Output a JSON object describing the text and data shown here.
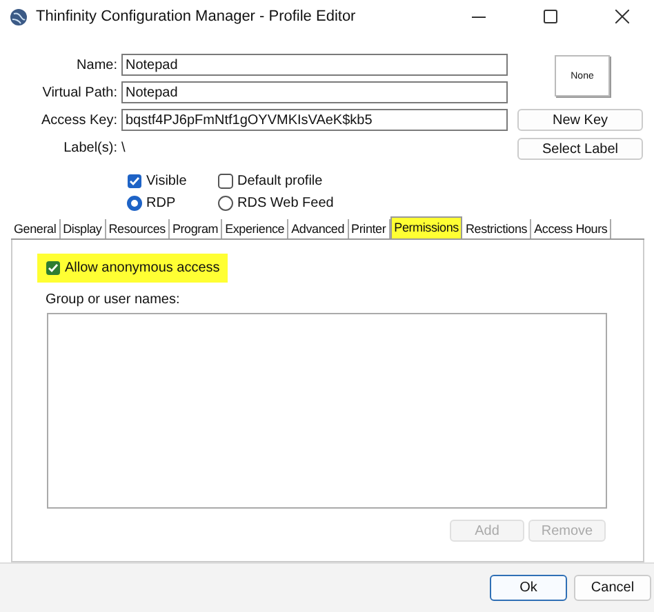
{
  "window": {
    "title": "Thinfinity Configuration Manager - Profile Editor"
  },
  "fields": [
    {
      "label": "Name:",
      "value": "Notepad"
    },
    {
      "label": "Virtual Path:",
      "value": "Notepad"
    },
    {
      "label": "Access Key:",
      "value": "bqstf4PJ6pFmNtf1gOYVMKIsVAeK$kb5"
    }
  ],
  "labels_row": {
    "label": "Label(s):",
    "value": "\\"
  },
  "icon_preview": {
    "text": "None"
  },
  "side_buttons": [
    "New Key",
    "Select Label"
  ],
  "options": [
    {
      "kind": "checkbox",
      "label": "Visible",
      "checked": true
    },
    {
      "kind": "checkbox",
      "label": "Default profile",
      "checked": false
    },
    {
      "kind": "radio",
      "label": "RDP",
      "checked": true
    },
    {
      "kind": "radio",
      "label": "RDS Web Feed",
      "checked": false
    }
  ],
  "tabs": [
    {
      "label": "General",
      "selected": false,
      "highlighted": false
    },
    {
      "label": "Display",
      "selected": false,
      "highlighted": false
    },
    {
      "label": "Resources",
      "selected": false,
      "highlighted": false
    },
    {
      "label": "Program",
      "selected": false,
      "highlighted": false
    },
    {
      "label": "Experience",
      "selected": false,
      "highlighted": false
    },
    {
      "label": "Advanced",
      "selected": false,
      "highlighted": false
    },
    {
      "label": "Printer",
      "selected": false,
      "highlighted": false
    },
    {
      "label": "Permissions",
      "selected": true,
      "highlighted": true
    },
    {
      "label": "Restrictions",
      "selected": false,
      "highlighted": false
    },
    {
      "label": "Access Hours",
      "selected": false,
      "highlighted": false
    }
  ],
  "permissions": {
    "anonymous": {
      "label": "Allow anonymous access",
      "checked": true,
      "highlighted": true
    },
    "list_label": "Group or user names:",
    "buttons": [
      {
        "label": "Add",
        "disabled": true
      },
      {
        "label": "Remove",
        "disabled": true
      }
    ]
  },
  "footer_buttons": [
    {
      "label": "Ok",
      "default": true
    },
    {
      "label": "Cancel",
      "default": false
    }
  ]
}
